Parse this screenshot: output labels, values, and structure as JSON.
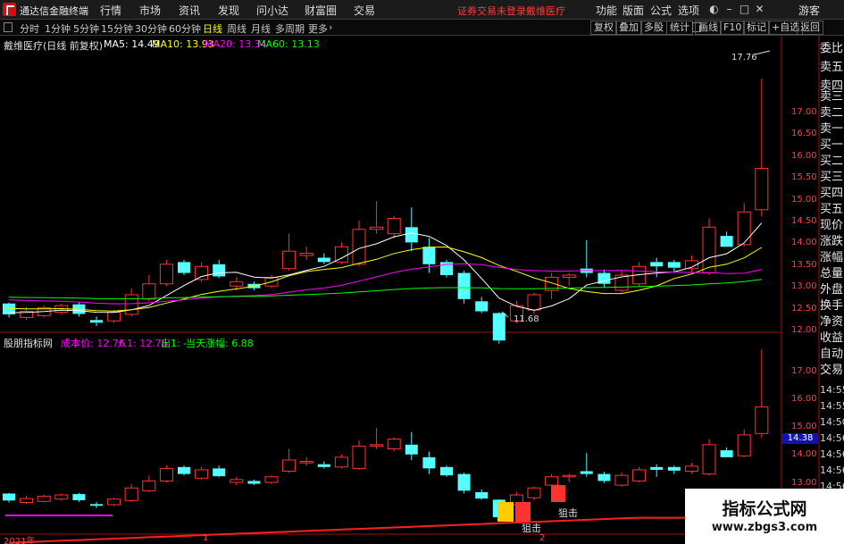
{
  "app": {
    "title": "通达信金融终端",
    "menu": [
      "行情",
      "市场",
      "资讯",
      "发现",
      "问小达",
      "财富圈",
      "交易"
    ],
    "notice": "证券交易未登录",
    "stock_link": "戴维医疗",
    "right_menu": [
      "功能",
      "版面",
      "公式",
      "选项"
    ],
    "user": "游客"
  },
  "periods": {
    "items": [
      "分时",
      "1分钟",
      "5分钟",
      "15分钟",
      "30分钟",
      "60分钟",
      "日线",
      "周线",
      "月线",
      "多周期",
      "更多"
    ],
    "selected": "日线"
  },
  "toolbar_buttons": [
    "复权",
    "叠加",
    "多股",
    "统计",
    "画线",
    "F10",
    "标记",
    "+自选",
    "返回"
  ],
  "main_chart": {
    "stock_title": "戴维医疗(日线 前复权)",
    "ma_labels": [
      {
        "text": "MA5: 14.49",
        "color": "#ffffff"
      },
      {
        "text": "MA10: 13.93",
        "color": "#ffff00"
      },
      {
        "text": "MA20: 13.34",
        "color": "#ff00ff"
      },
      {
        "text": "MA60: 13.13",
        "color": "#00ff00"
      }
    ],
    "high_label": "17.76",
    "low_label": "11.68",
    "axis_ticks": [
      "17.00",
      "16.50",
      "16.00",
      "15.50",
      "15.00",
      "14.50",
      "14.00",
      "13.50",
      "13.00",
      "12.50",
      "12.00"
    ]
  },
  "indicator": {
    "name": "股朋指标网",
    "labels": [
      {
        "text": "成本价: 12.76",
        "color": "#ff00ff"
      },
      {
        "text": "入1: 12.76",
        "color": "#ff00ff"
      },
      {
        "text": "出1: -",
        "color": "#00ff00"
      },
      {
        "text": "当天涨幅: 6.88",
        "color": "#00ff00"
      }
    ],
    "signal_label": "狙击",
    "axis_ticks": [
      "17.00",
      "16.00",
      "15.00",
      "14.00",
      "13.00"
    ],
    "price_tag": "14.38"
  },
  "side_panel": {
    "items": [
      "委比",
      "卖五",
      "卖四",
      "卖三",
      "卖二",
      "卖一",
      "买一",
      "买二",
      "买三",
      "买四",
      "买五",
      "现价",
      "涨跌",
      "涨幅",
      "总量",
      "外盘",
      "换手",
      "净资",
      "收益",
      "自动",
      "交易"
    ],
    "times": [
      "14:55",
      "14:55",
      "14:50",
      "14:56",
      "14:56",
      "14:56",
      "14:56"
    ]
  },
  "bottom_axis": {
    "year": "2021年",
    "marks": [
      "1",
      "2"
    ]
  },
  "watermark": {
    "title": "指标公式网",
    "url": "www.zbgs3.com"
  },
  "colors": {
    "up": "#ff3232",
    "down": "#54ffff",
    "ma5": "#ffffff",
    "ma10": "#ffff00",
    "ma20": "#ff00ff",
    "ma60": "#00ff00",
    "cost_line": "#ff2020",
    "signal_yellow": "#ffcc00"
  },
  "chart_data": {
    "type": "candlestick",
    "series": [
      {
        "name": "K",
        "ohlc": [
          [
            12.6,
            12.62,
            12.28,
            12.35
          ],
          [
            12.28,
            12.52,
            12.22,
            12.42
          ],
          [
            12.32,
            12.55,
            12.28,
            12.5
          ],
          [
            12.4,
            12.6,
            12.35,
            12.55
          ],
          [
            12.58,
            12.62,
            12.3,
            12.36
          ],
          [
            12.22,
            12.3,
            12.08,
            12.16
          ],
          [
            12.2,
            12.45,
            12.15,
            12.4
          ],
          [
            12.35,
            12.95,
            12.3,
            12.8
          ],
          [
            12.7,
            13.25,
            12.65,
            13.05
          ],
          [
            13.05,
            13.6,
            13.0,
            13.5
          ],
          [
            13.55,
            13.6,
            13.25,
            13.3
          ],
          [
            13.15,
            13.55,
            13.1,
            13.45
          ],
          [
            13.5,
            13.6,
            13.18,
            13.22
          ],
          [
            13.0,
            13.2,
            12.9,
            13.1
          ],
          [
            13.05,
            13.1,
            12.9,
            12.95
          ],
          [
            13.0,
            13.25,
            12.95,
            13.2
          ],
          [
            13.4,
            14.2,
            13.35,
            13.8
          ],
          [
            13.7,
            13.9,
            13.6,
            13.75
          ],
          [
            13.65,
            13.75,
            13.5,
            13.55
          ],
          [
            13.55,
            14.0,
            13.5,
            13.9
          ],
          [
            13.5,
            14.5,
            13.45,
            14.3
          ],
          [
            14.3,
            14.95,
            14.2,
            14.35
          ],
          [
            14.2,
            14.6,
            14.1,
            14.55
          ],
          [
            14.35,
            14.8,
            13.8,
            14.0
          ],
          [
            13.9,
            14.1,
            13.3,
            13.5
          ],
          [
            13.55,
            13.6,
            13.2,
            13.25
          ],
          [
            13.3,
            13.35,
            12.6,
            12.7
          ],
          [
            12.65,
            12.75,
            12.38,
            12.42
          ],
          [
            12.38,
            12.4,
            11.68,
            11.75
          ],
          [
            12.2,
            12.65,
            12.15,
            12.55
          ],
          [
            12.45,
            12.85,
            12.35,
            12.8
          ],
          [
            12.9,
            13.3,
            12.7,
            13.2
          ],
          [
            13.2,
            13.3,
            13.0,
            13.25
          ],
          [
            13.4,
            14.05,
            13.2,
            13.3
          ],
          [
            13.3,
            13.38,
            12.98,
            13.05
          ],
          [
            12.9,
            13.35,
            12.85,
            13.25
          ],
          [
            13.05,
            13.55,
            13.0,
            13.45
          ],
          [
            13.55,
            13.65,
            13.2,
            13.45
          ],
          [
            13.55,
            13.6,
            13.3,
            13.42
          ],
          [
            13.4,
            13.7,
            13.3,
            13.58
          ],
          [
            13.3,
            14.55,
            13.25,
            14.35
          ],
          [
            14.15,
            14.25,
            13.9,
            13.9
          ],
          [
            13.95,
            14.9,
            13.9,
            14.7
          ],
          [
            14.75,
            17.76,
            14.6,
            15.7
          ]
        ]
      }
    ],
    "x_labels": [
      "2021年",
      "1",
      "2"
    ],
    "ylim": [
      11.6,
      17.8
    ]
  }
}
